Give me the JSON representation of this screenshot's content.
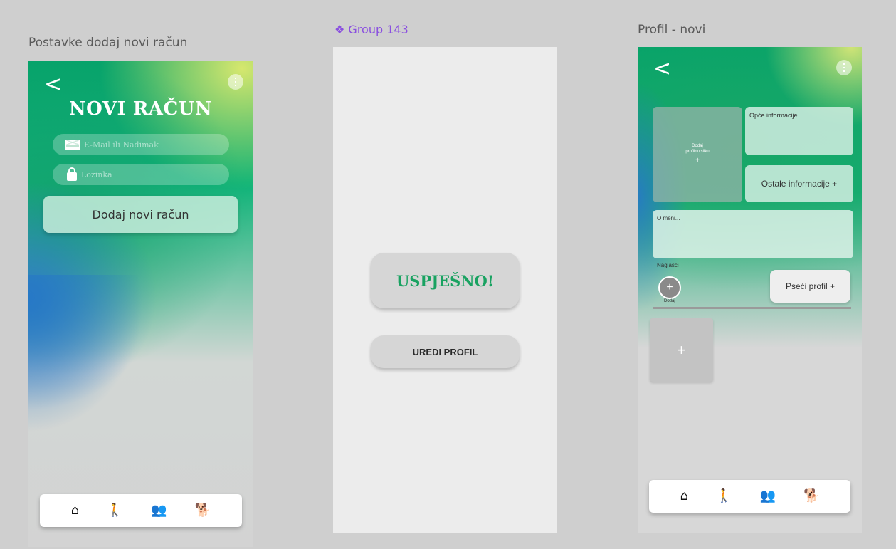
{
  "frames": {
    "left": {
      "label": "Postavke dodaj novi račun",
      "back_glyph": "<",
      "title": "NOVI RAČUN",
      "email_placeholder": "E-Mail ili Nadimak",
      "password_placeholder": "Lozinka",
      "add_button": "Dodaj novi račun"
    },
    "middle": {
      "label": "❖ Group 143",
      "success": "USPJEŠNO!",
      "edit_profile": "UREDI PROFIL"
    },
    "right": {
      "label": "Profil - novi",
      "back_glyph": "<",
      "add_photo_line1": "Dodaj",
      "add_photo_line2": "profilnu sliku",
      "add_photo_plus": "+",
      "general_info": "Opće informacije...",
      "other_info": "Ostale informacije  +",
      "about_me": "O meni...",
      "highlights": "Naglasci",
      "add_plus": "+",
      "add_label": "Dodaj",
      "dog_profile": "Pseći profil  +",
      "tile_plus": "+"
    }
  },
  "navbar": {
    "icons": [
      "home-icon",
      "dog-walker-icon",
      "group-icon",
      "dog-icon"
    ],
    "glyphs": {
      "home": "⌂",
      "walk": "🚶",
      "group": "👥",
      "dog": "🐕"
    },
    "colors": {
      "home": "#111111",
      "walk": "#1f9f4e",
      "group": "#e8c14f",
      "dog": "#3a7bc4"
    }
  },
  "colors": {
    "brand_green": "#06a36a",
    "success_text": "#19a261",
    "group_label": "#8a4fe0"
  }
}
